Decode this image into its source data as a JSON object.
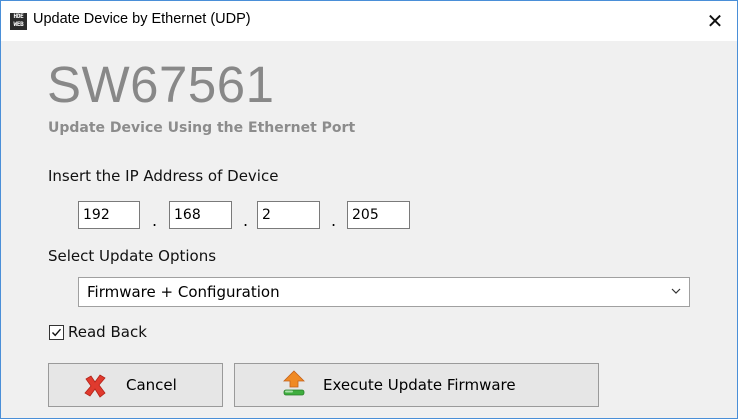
{
  "window": {
    "title": "Update Device by Ethernet (UDP)",
    "close_glyph": "✕",
    "icon": "webudp-app-icon",
    "icon_text_top": "HDE",
    "icon_text_bottom": "WEB"
  },
  "header": {
    "product_code": "SW67561",
    "subtitle": "Update Device Using the Ethernet Port"
  },
  "ip_section": {
    "label": "Insert the IP Address of Device",
    "octets": [
      "192",
      "168",
      "2",
      "205"
    ],
    "separator": "."
  },
  "update_options": {
    "label": "Select Update Options",
    "selected": "Firmware + Configuration"
  },
  "read_back": {
    "label": "Read Back",
    "checked": true
  },
  "buttons": {
    "cancel_label": "Cancel",
    "cancel_icon": "red-x-icon",
    "execute_label": "Execute Update Firmware",
    "execute_icon": "upload-arrow-icon"
  },
  "colors": {
    "window_border": "#4a8fd8",
    "content_bg": "#f0f0f0",
    "product_code": "#888888",
    "cancel_icon": "#e03a2e",
    "upload_arrow": "#f08a24",
    "upload_bar": "#3fae3f"
  }
}
